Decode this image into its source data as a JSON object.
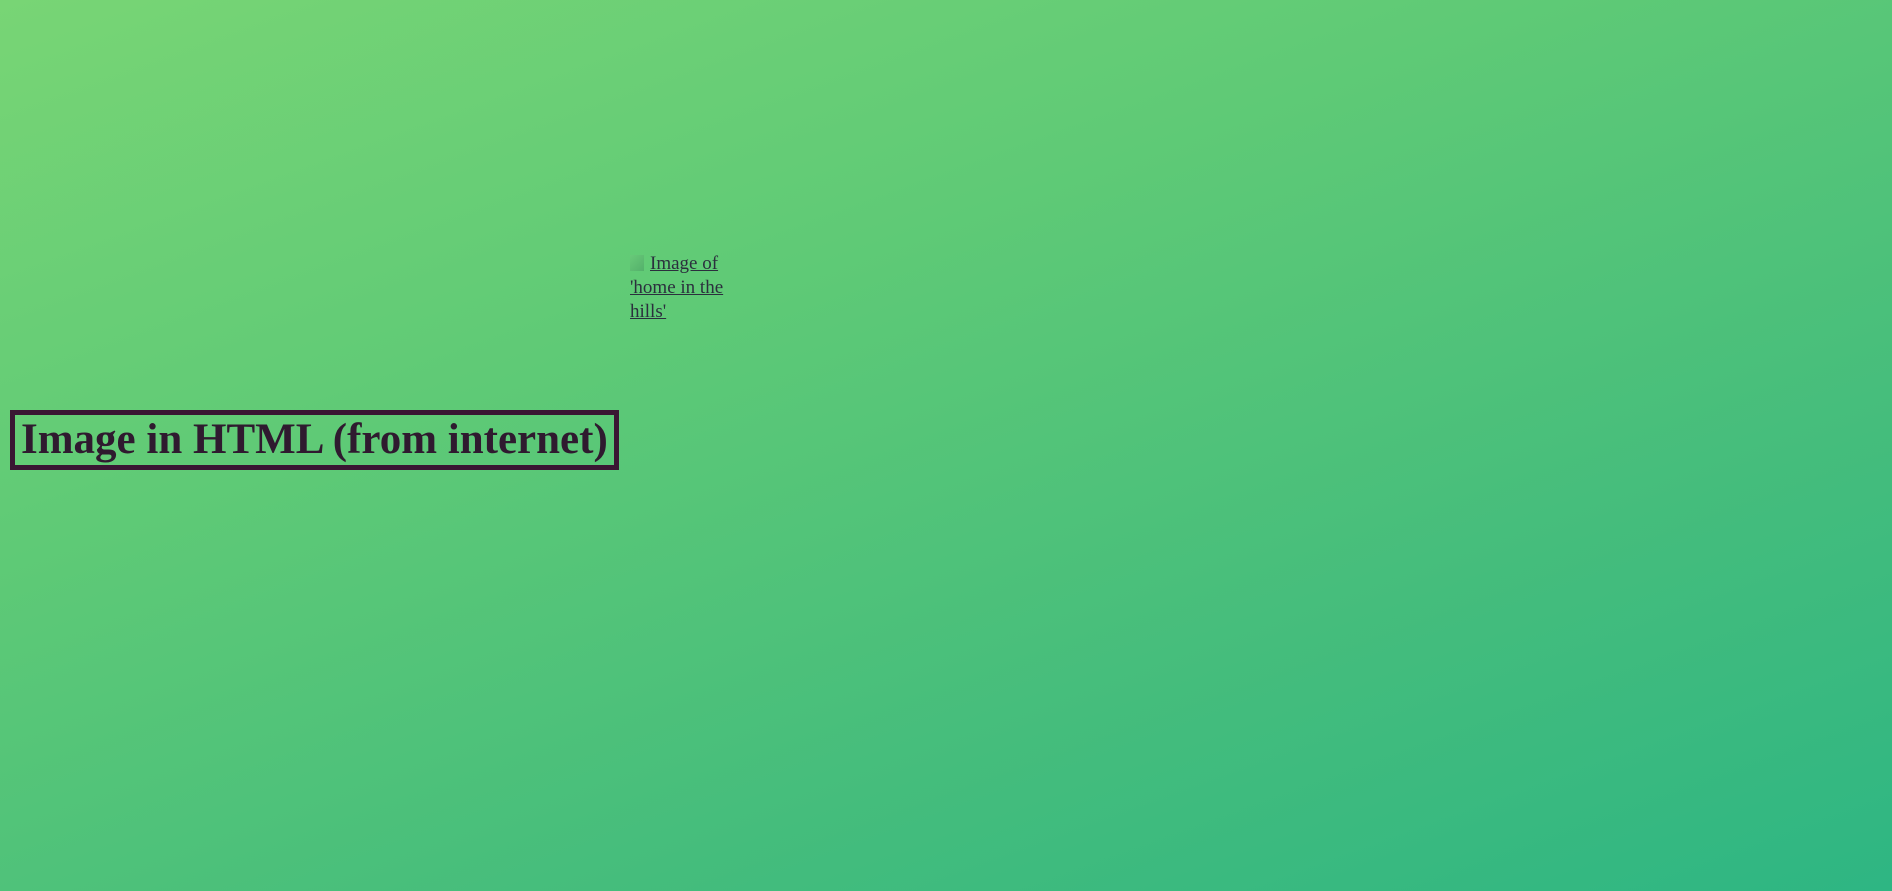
{
  "page": {
    "heading": "Image in HTML (from internet)",
    "image_alt": "Image of 'home in the hills'"
  },
  "icons": {
    "broken_image": "broken-image-icon"
  },
  "colors": {
    "gradient_start": "#78d575",
    "gradient_end": "#2eb683",
    "heading_text": "#2f1a2f",
    "heading_border": "#3a1633",
    "link_text": "#2b2f3d"
  }
}
